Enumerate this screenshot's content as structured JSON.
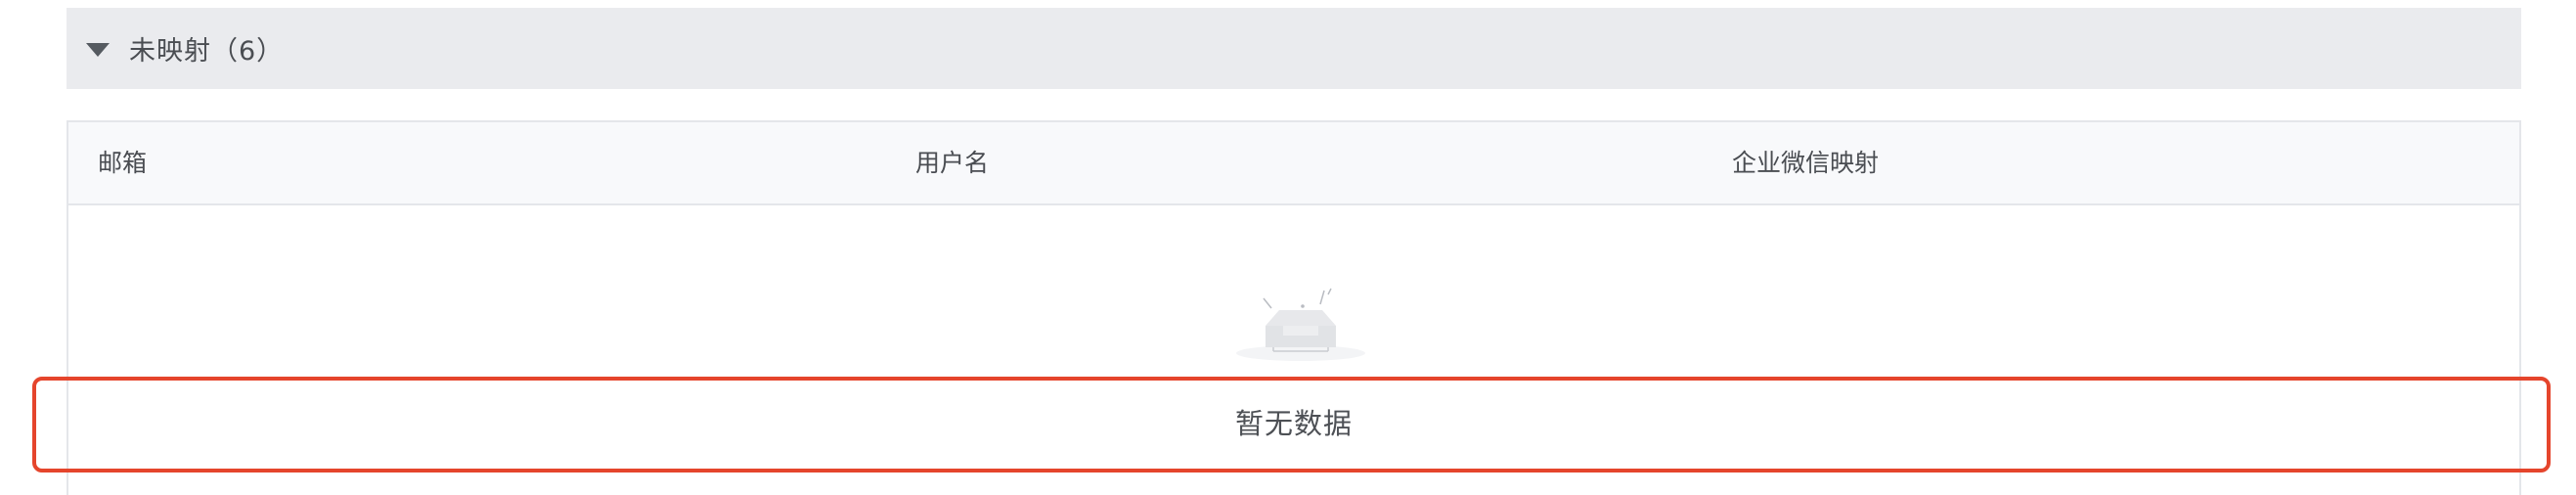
{
  "section": {
    "title": "未映射（6）",
    "expanded": true,
    "caret_icon": "caret-down-icon"
  },
  "table": {
    "columns": [
      {
        "label": "邮箱"
      },
      {
        "label": "用户名"
      },
      {
        "label": "企业微信映射"
      }
    ],
    "rows": [],
    "empty": {
      "icon": "empty-inbox-icon",
      "text": "暂无数据"
    }
  },
  "annotation": {
    "color": "#e5452c"
  },
  "colors": {
    "header_bg": "#eaebee",
    "table_head_bg": "#f8f9fb",
    "border": "#e4e6ea"
  }
}
